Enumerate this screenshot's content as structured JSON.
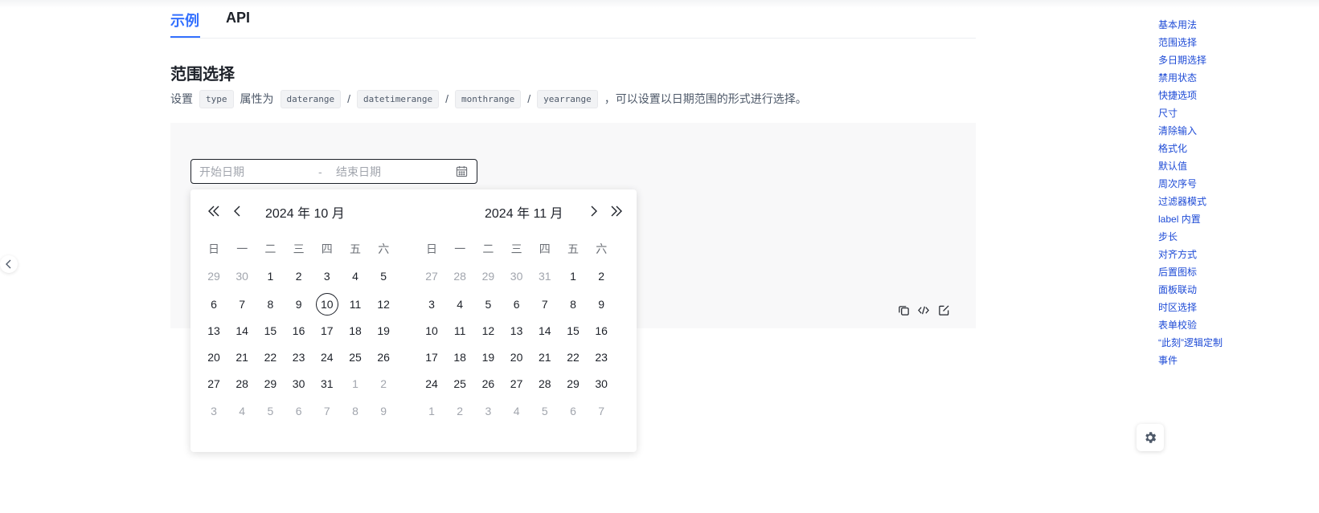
{
  "tabs": {
    "demo": "示例",
    "api": "API"
  },
  "section": {
    "title": "范围选择",
    "desc": {
      "prefix": "设置",
      "code_type": "type",
      "mid": "属性为",
      "codes": [
        "daterange",
        "datetimerange",
        "monthrange",
        "yearrange"
      ],
      "suffix": "，可以设置以日期范围的形式进行选择。"
    }
  },
  "range_input": {
    "start_placeholder": "开始日期",
    "separator": "-",
    "end_placeholder": "结束日期"
  },
  "calendar": {
    "weekdays": [
      "日",
      "一",
      "二",
      "三",
      "四",
      "五",
      "六"
    ],
    "left": {
      "title": "2024 年 10 月",
      "weeks": [
        [
          "29",
          "30",
          "1",
          "2",
          "3",
          "4",
          "5"
        ],
        [
          "6",
          "7",
          "8",
          "9",
          "10",
          "11",
          "12"
        ],
        [
          "13",
          "14",
          "15",
          "16",
          "17",
          "18",
          "19"
        ],
        [
          "20",
          "21",
          "22",
          "23",
          "24",
          "25",
          "26"
        ],
        [
          "27",
          "28",
          "29",
          "30",
          "31",
          "1",
          "2"
        ],
        [
          "3",
          "4",
          "5",
          "6",
          "7",
          "8",
          "9"
        ]
      ]
    },
    "right": {
      "title": "2024 年 11 月",
      "weeks": [
        [
          "27",
          "28",
          "29",
          "30",
          "31",
          "1",
          "2"
        ],
        [
          "3",
          "4",
          "5",
          "6",
          "7",
          "8",
          "9"
        ],
        [
          "10",
          "11",
          "12",
          "13",
          "14",
          "15",
          "16"
        ],
        [
          "17",
          "18",
          "19",
          "20",
          "21",
          "22",
          "23"
        ],
        [
          "24",
          "25",
          "26",
          "27",
          "28",
          "29",
          "30"
        ],
        [
          "1",
          "2",
          "3",
          "4",
          "5",
          "6",
          "7"
        ]
      ]
    },
    "today": "10"
  },
  "toc": [
    "基本用法",
    "范围选择",
    "多日期选择",
    "禁用状态",
    "快捷选项",
    "尺寸",
    "清除输入",
    "格式化",
    "默认值",
    "周次序号",
    "过滤器模式",
    "label 内置",
    "步长",
    "对齐方式",
    "后置图标",
    "面板联动",
    "时区选择",
    "表单校验",
    "“此刻”逻辑定制",
    "事件"
  ],
  "colors": {
    "accent": "#3370ff",
    "link": "#1e4bd6",
    "muted": "#a1a5ad"
  }
}
